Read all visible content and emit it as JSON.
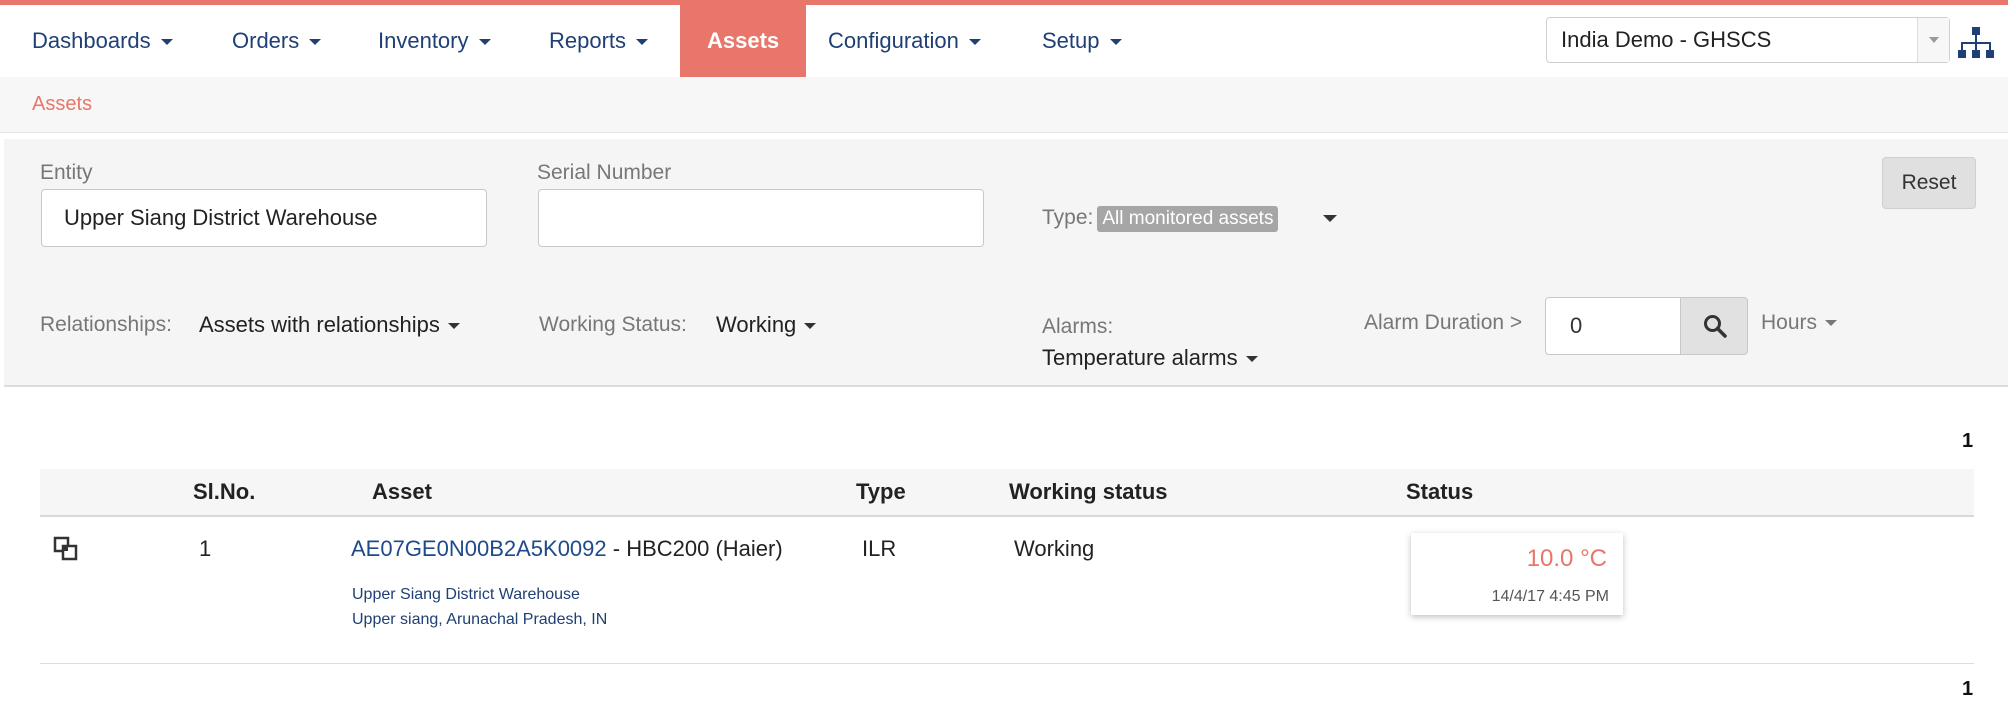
{
  "nav": {
    "items": [
      {
        "label": "Dashboards",
        "caret": true
      },
      {
        "label": "Orders",
        "caret": true
      },
      {
        "label": "Inventory",
        "caret": true
      },
      {
        "label": "Reports",
        "caret": true
      },
      {
        "label": "Assets",
        "caret": false,
        "active": true
      },
      {
        "label": "Configuration",
        "caret": true
      },
      {
        "label": "Setup",
        "caret": true
      }
    ],
    "domain": "India Demo - GHSCS",
    "hierarchy_icon": "org-hierarchy-icon"
  },
  "breadcrumb": "Assets",
  "filters": {
    "entity_label": "Entity",
    "entity_value": "Upper Siang District Warehouse",
    "serial_label": "Serial Number",
    "serial_value": "",
    "type_label": "Type:",
    "type_value": "All monitored assets",
    "reset": "Reset",
    "relationships_label": "Relationships:",
    "relationships_value": "Assets with relationships",
    "working_status_label": "Working Status:",
    "working_status_value": "Working",
    "alarms_label": "Alarms:",
    "alarms_value": "Temperature alarms",
    "alarm_duration_label": "Alarm Duration >",
    "alarm_duration_value": "0",
    "hours": "Hours"
  },
  "table": {
    "page_top": "1",
    "page_bottom": "1",
    "headers": {
      "slno": "Sl.No.",
      "asset": "Asset",
      "type": "Type",
      "working": "Working status",
      "status": "Status"
    },
    "rows": [
      {
        "slno": "1",
        "asset_id": "AE07GE0N00B2A5K0092",
        "asset_model": " - HBC200 (Haier)",
        "entity": "Upper Siang District Warehouse",
        "location": "Upper siang, Arunachal Pradesh, IN",
        "type": "ILR",
        "working": "Working",
        "temperature": "10.0 °C",
        "timestamp": "14/4/17 4:45 PM"
      }
    ]
  },
  "colors": {
    "accent": "#e8766a",
    "link": "#1f4a8a"
  }
}
